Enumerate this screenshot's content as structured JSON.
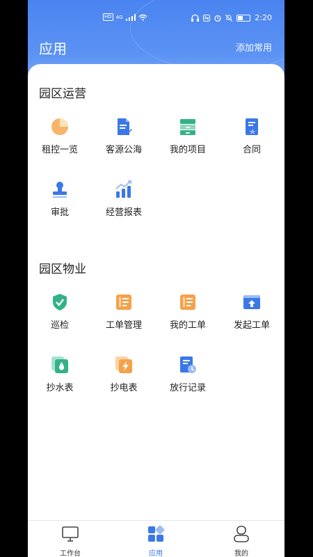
{
  "status_bar": {
    "time": "2:20",
    "network": "4G",
    "hd": "HD"
  },
  "header": {
    "title": "应用",
    "action_label": "添加常用"
  },
  "sections": [
    {
      "title": "园区运营",
      "items": [
        {
          "label": "租控一览",
          "icon": "pie-chart-icon",
          "color": "#f5a14a"
        },
        {
          "label": "客源公海",
          "icon": "document-edit-icon",
          "color": "#3b78e7"
        },
        {
          "label": "我的项目",
          "icon": "drawer-icon",
          "color": "#33b28a"
        },
        {
          "label": "合同",
          "icon": "contract-icon",
          "color": "#3b78e7"
        },
        {
          "label": "审批",
          "icon": "stamp-icon",
          "color": "#3b78e7"
        },
        {
          "label": "经营报表",
          "icon": "bar-chart-trend-icon",
          "color": "#3b78e7"
        }
      ]
    },
    {
      "title": "园区物业",
      "items": [
        {
          "label": "巡检",
          "icon": "shield-check-icon",
          "color": "#33b28a"
        },
        {
          "label": "工单管理",
          "icon": "work-order-icon",
          "color": "#f5a14a"
        },
        {
          "label": "我的工单",
          "icon": "my-work-order-icon",
          "color": "#f5a14a"
        },
        {
          "label": "发起工单",
          "icon": "upload-window-icon",
          "color": "#3b78e7"
        },
        {
          "label": "抄水表",
          "icon": "water-drop-icon",
          "color": "#33b28a"
        },
        {
          "label": "抄电表",
          "icon": "lightning-icon",
          "color": "#f5a14a"
        },
        {
          "label": "放行记录",
          "icon": "clock-document-icon",
          "color": "#3b78e7"
        }
      ]
    }
  ],
  "tabbar": [
    {
      "label": "工作台",
      "icon": "monitor-icon"
    },
    {
      "label": "应用",
      "icon": "apps-grid-icon",
      "active": true
    },
    {
      "label": "我的",
      "icon": "user-icon"
    }
  ]
}
